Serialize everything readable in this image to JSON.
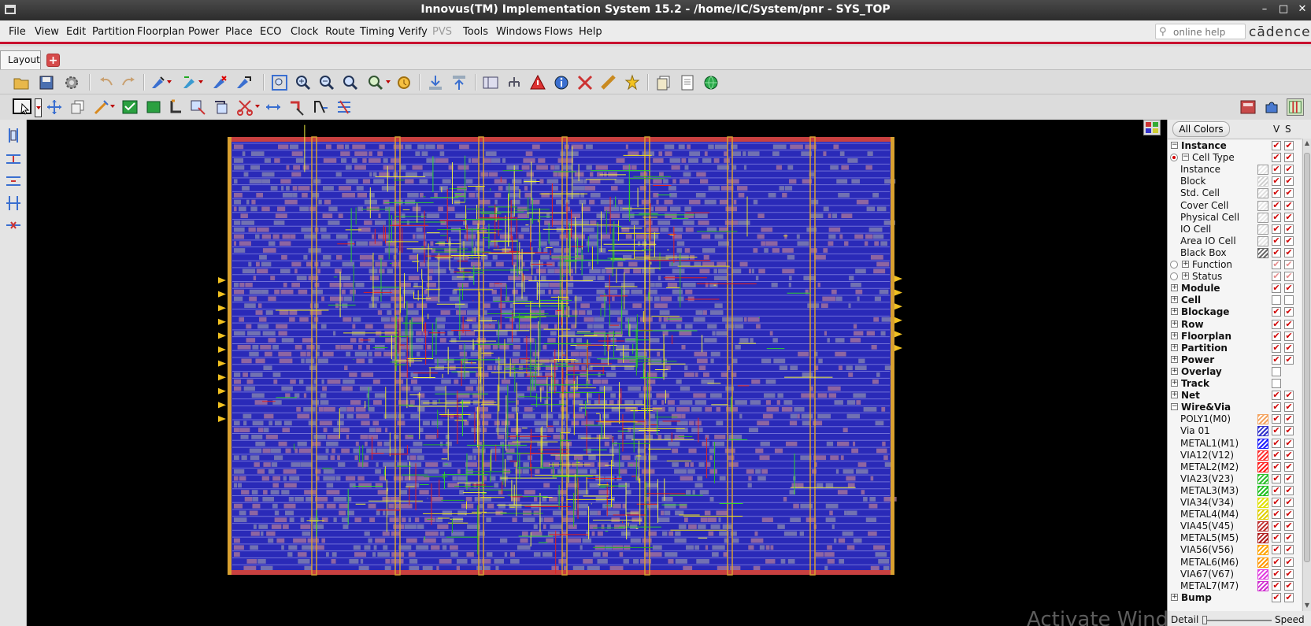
{
  "window": {
    "title": "Innovus(TM) Implementation System 15.2 - /home/IC/System/pnr - SYS_TOP"
  },
  "menu": [
    {
      "label": "File",
      "enabled": true
    },
    {
      "label": "View",
      "enabled": true
    },
    {
      "label": "Edit",
      "enabled": true
    },
    {
      "label": "Partition",
      "enabled": true
    },
    {
      "label": "Floorplan",
      "enabled": true
    },
    {
      "label": "Power",
      "enabled": true
    },
    {
      "label": "Place",
      "enabled": true
    },
    {
      "label": "ECO",
      "enabled": true
    },
    {
      "label": "Clock",
      "enabled": true
    },
    {
      "label": "Route",
      "enabled": true
    },
    {
      "label": "Timing",
      "enabled": true
    },
    {
      "label": "Verify",
      "enabled": true
    },
    {
      "label": "PVS",
      "enabled": false
    },
    {
      "label": "Tools",
      "enabled": true
    },
    {
      "label": "Windows",
      "enabled": true
    },
    {
      "label": "Flows",
      "enabled": true
    },
    {
      "label": "Help",
      "enabled": true
    }
  ],
  "help": {
    "placeholder": "online help",
    "brand": "cādence"
  },
  "tabs": {
    "active": "Layout"
  },
  "toolbar1_icons": [
    "open-icon",
    "save-icon",
    "settings-icon",
    "undo-icon",
    "redo-icon",
    "place-wire-icon",
    "route-icon",
    "eco-icon",
    "optimize-icon",
    "zoom-fit-icon",
    "zoom-in-icon",
    "zoom-out-icon",
    "zoom-area-icon",
    "zoom-select-icon",
    "refresh-icon",
    "move-in-icon",
    "move-out-icon",
    "floorplan-view-icon",
    "hierarchy-icon",
    "violation-icon",
    "info-icon",
    "ruler-icon",
    "measure-icon",
    "highlight-icon",
    "copy-icon",
    "notes-icon",
    "globe-icon"
  ],
  "toolbar2_icons": [
    "select-icon",
    "move-icon",
    "copy-icon",
    "edit-wire-icon",
    "wire-check-icon",
    "rect-icon",
    "stretch-icon",
    "add-shape-icon",
    "cut-icon",
    "spread-icon",
    "cut-wire-icon",
    "split-icon",
    "trim-icon",
    "stack-icon"
  ],
  "left_tools": [
    "align-vertical-icon",
    "distribute-icon",
    "distribute-center-icon",
    "space-icon",
    "delete-space-icon"
  ],
  "canvas": {
    "watermark": "Activate Windo"
  },
  "panel": {
    "all_colors": "All Colors",
    "col_v": "V",
    "col_s": "S",
    "items": [
      {
        "label": "Instance",
        "bold": true,
        "level": 0,
        "expander": "-",
        "v": true,
        "s": true
      },
      {
        "label": "Cell Type",
        "bold": false,
        "level": 1,
        "expander": "-",
        "radio": "on",
        "v": true,
        "s": true
      },
      {
        "label": "Instance",
        "bold": false,
        "level": 2,
        "swatch": "#e8e8e8",
        "v": true,
        "s": true
      },
      {
        "label": "Block",
        "bold": false,
        "level": 2,
        "swatch": "#d0d0d0",
        "v": true,
        "s": true
      },
      {
        "label": "Std. Cell",
        "bold": false,
        "level": 2,
        "swatch": "#e0e0e0",
        "v": true,
        "s": true
      },
      {
        "label": "Cover Cell",
        "bold": false,
        "level": 2,
        "swatch": "#e6e6e6",
        "v": true,
        "s": true
      },
      {
        "label": "Physical Cell",
        "bold": false,
        "level": 2,
        "swatch": "#e6e6e6",
        "v": true,
        "s": true
      },
      {
        "label": "IO Cell",
        "bold": false,
        "level": 2,
        "swatch": "#e6e6e6",
        "v": true,
        "s": true
      },
      {
        "label": "Area IO Cell",
        "bold": false,
        "level": 2,
        "swatch": "#e6e6e6",
        "v": true,
        "s": true
      },
      {
        "label": "Black Box",
        "bold": false,
        "level": 2,
        "swatch": "#6a6a6a",
        "v": true,
        "s": true
      },
      {
        "label": "Function",
        "bold": false,
        "level": 1,
        "expander": "+",
        "radio": "off",
        "v": true,
        "s": true,
        "dim": true
      },
      {
        "label": "Status",
        "bold": false,
        "level": 1,
        "expander": "+",
        "radio": "off",
        "v": true,
        "s": true,
        "dim": true
      },
      {
        "label": "Module",
        "bold": true,
        "level": 0,
        "expander": "+",
        "v": true,
        "s": true
      },
      {
        "label": "Cell",
        "bold": true,
        "level": 0,
        "expander": "+",
        "v": false,
        "s": false
      },
      {
        "label": "Blockage",
        "bold": true,
        "level": 0,
        "expander": "+",
        "v": true,
        "s": true
      },
      {
        "label": "Row",
        "bold": true,
        "level": 0,
        "expander": "+",
        "v": true,
        "s": true
      },
      {
        "label": "Floorplan",
        "bold": true,
        "level": 0,
        "expander": "+",
        "v": true,
        "s": true
      },
      {
        "label": "Partition",
        "bold": true,
        "level": 0,
        "expander": "+",
        "v": true,
        "s": true
      },
      {
        "label": "Power",
        "bold": true,
        "level": 0,
        "expander": "+",
        "v": true,
        "s": true
      },
      {
        "label": "Overlay",
        "bold": true,
        "level": 0,
        "expander": "+",
        "v": false,
        "s": null
      },
      {
        "label": "Track",
        "bold": true,
        "level": 0,
        "expander": "+",
        "v": false,
        "s": null
      },
      {
        "label": "Net",
        "bold": true,
        "level": 0,
        "expander": "+",
        "v": true,
        "s": true
      },
      {
        "label": "Wire&Via",
        "bold": true,
        "level": 0,
        "expander": "-",
        "v": true,
        "s": true
      },
      {
        "label": "POLY1(M0)",
        "bold": false,
        "level": 2,
        "swatch": "#f4a460",
        "v": true,
        "s": true
      },
      {
        "label": "Via 01",
        "bold": false,
        "level": 2,
        "swatch": "#3333cc",
        "v": true,
        "s": true
      },
      {
        "label": "METAL1(M1)",
        "bold": false,
        "level": 2,
        "swatch": "#2020ff",
        "v": true,
        "s": true
      },
      {
        "label": "VIA12(V12)",
        "bold": false,
        "level": 2,
        "swatch": "#ff3030",
        "v": true,
        "s": true
      },
      {
        "label": "METAL2(M2)",
        "bold": false,
        "level": 2,
        "swatch": "#ff2020",
        "v": true,
        "s": true
      },
      {
        "label": "VIA23(V23)",
        "bold": false,
        "level": 2,
        "swatch": "#30c030",
        "v": true,
        "s": true
      },
      {
        "label": "METAL3(M3)",
        "bold": false,
        "level": 2,
        "swatch": "#20c020",
        "v": true,
        "s": true
      },
      {
        "label": "VIA34(V34)",
        "bold": false,
        "level": 2,
        "swatch": "#e0e000",
        "v": true,
        "s": true
      },
      {
        "label": "METAL4(M4)",
        "bold": false,
        "level": 2,
        "swatch": "#e0d000",
        "v": true,
        "s": true
      },
      {
        "label": "VIA45(V45)",
        "bold": false,
        "level": 2,
        "swatch": "#c03030",
        "v": true,
        "s": true
      },
      {
        "label": "METAL5(M5)",
        "bold": false,
        "level": 2,
        "swatch": "#b02020",
        "v": true,
        "s": true
      },
      {
        "label": "VIA56(V56)",
        "bold": false,
        "level": 2,
        "swatch": "#ffa500",
        "v": true,
        "s": true
      },
      {
        "label": "METAL6(M6)",
        "bold": false,
        "level": 2,
        "swatch": "#ff9900",
        "v": true,
        "s": true
      },
      {
        "label": "VIA67(V67)",
        "bold": false,
        "level": 2,
        "swatch": "#e040e0",
        "v": true,
        "s": true
      },
      {
        "label": "METAL7(M7)",
        "bold": false,
        "level": 2,
        "swatch": "#d030d0",
        "v": true,
        "s": true
      },
      {
        "label": "Bump",
        "bold": true,
        "level": 0,
        "expander": "+",
        "v": true,
        "s": true
      }
    ],
    "detail_label": "Detail",
    "speed_label": "Speed",
    "detail_speed": 0.0
  }
}
